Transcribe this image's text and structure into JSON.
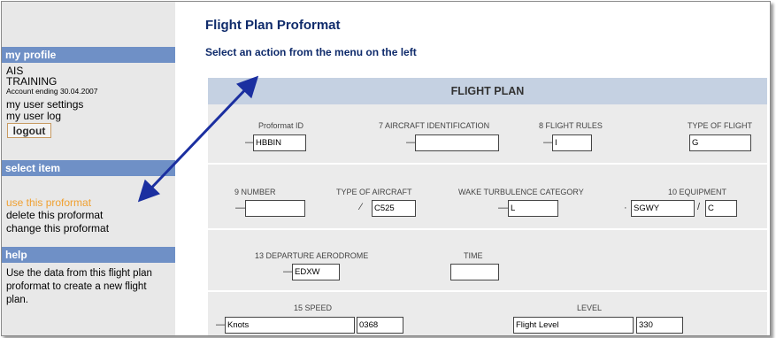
{
  "sidebar": {
    "my_profile_header": "my profile",
    "profile_lines": [
      "AIS",
      "TRAINING"
    ],
    "account_note": "Account ending 30.04.2007",
    "user_settings": "my user settings",
    "user_log": "my user log",
    "logout": "logout",
    "select_item_header": "select item",
    "items": [
      "use this proformat",
      "delete this proformat",
      "change this proformat"
    ],
    "help_header": "help",
    "help_text": "Use the data from this flight plan proformat to create a new flight plan."
  },
  "main": {
    "title": "Flight Plan Proformat",
    "subtitle": "Select an action from the menu on the left",
    "panel_title": "FLIGHT PLAN"
  },
  "form": {
    "proformat_id": {
      "label": "Proformat ID",
      "value": "HBBIN"
    },
    "aircraft_identification": {
      "label": "7 AIRCRAFT IDENTIFICATION",
      "value": ""
    },
    "flight_rules": {
      "label": "8 FLIGHT RULES",
      "value": "I"
    },
    "type_of_flight": {
      "label": "TYPE OF FLIGHT",
      "value": "G"
    },
    "number": {
      "label": "9 NUMBER",
      "value": ""
    },
    "type_of_aircraft": {
      "label": "TYPE OF AIRCRAFT",
      "value": "C525"
    },
    "wake_turbulence": {
      "label": "WAKE TURBULENCE CATEGORY",
      "value": "L"
    },
    "equipment": {
      "label": "10 EQUIPMENT",
      "value": "SGWY",
      "value2": "C"
    },
    "departure_aerodrome": {
      "label": "13 DEPARTURE AERODROME",
      "value": "EDXW"
    },
    "time": {
      "label": "TIME",
      "value": ""
    },
    "speed": {
      "label": "15 SPEED",
      "unit": "Knots",
      "value": "0368"
    },
    "level": {
      "label": "LEVEL",
      "unit": "Flight Level",
      "value": "330"
    }
  },
  "colors": {
    "accent": "#6f90c6",
    "title": "#0f2b6b",
    "active_item": "#f0a030",
    "arrow": "#1b2fa0"
  },
  "icons": [
    "double-headed-arrow-icon"
  ]
}
